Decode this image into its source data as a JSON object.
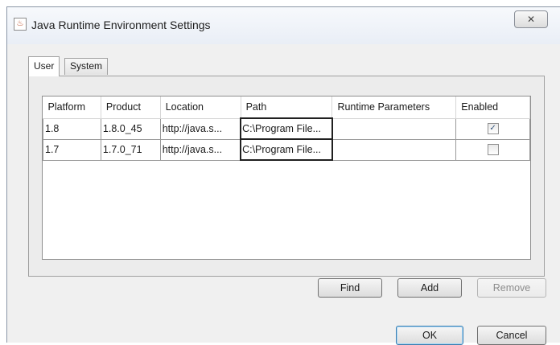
{
  "window": {
    "title": "Java Runtime Environment Settings",
    "close_symbol": "✕"
  },
  "tabs": [
    {
      "label": "User",
      "selected": true
    },
    {
      "label": "System",
      "selected": false
    }
  ],
  "table": {
    "columns": [
      "Platform",
      "Product",
      "Location",
      "Path",
      "Runtime Parameters",
      "Enabled"
    ],
    "rows": [
      {
        "platform": "1.8",
        "product": "1.8.0_45",
        "location": "http://java.s...",
        "path": "C:\\Program File...",
        "runtime_parameters": "",
        "enabled": true
      },
      {
        "platform": "1.7",
        "product": "1.7.0_71",
        "location": "http://java.s...",
        "path": "C:\\Program File...",
        "runtime_parameters": "",
        "enabled": false
      }
    ]
  },
  "buttons": {
    "find": "Find",
    "add": "Add",
    "remove": "Remove",
    "ok": "OK",
    "cancel": "Cancel"
  },
  "icons": {
    "app": "java-cup-icon",
    "check_glyph": "✓"
  }
}
